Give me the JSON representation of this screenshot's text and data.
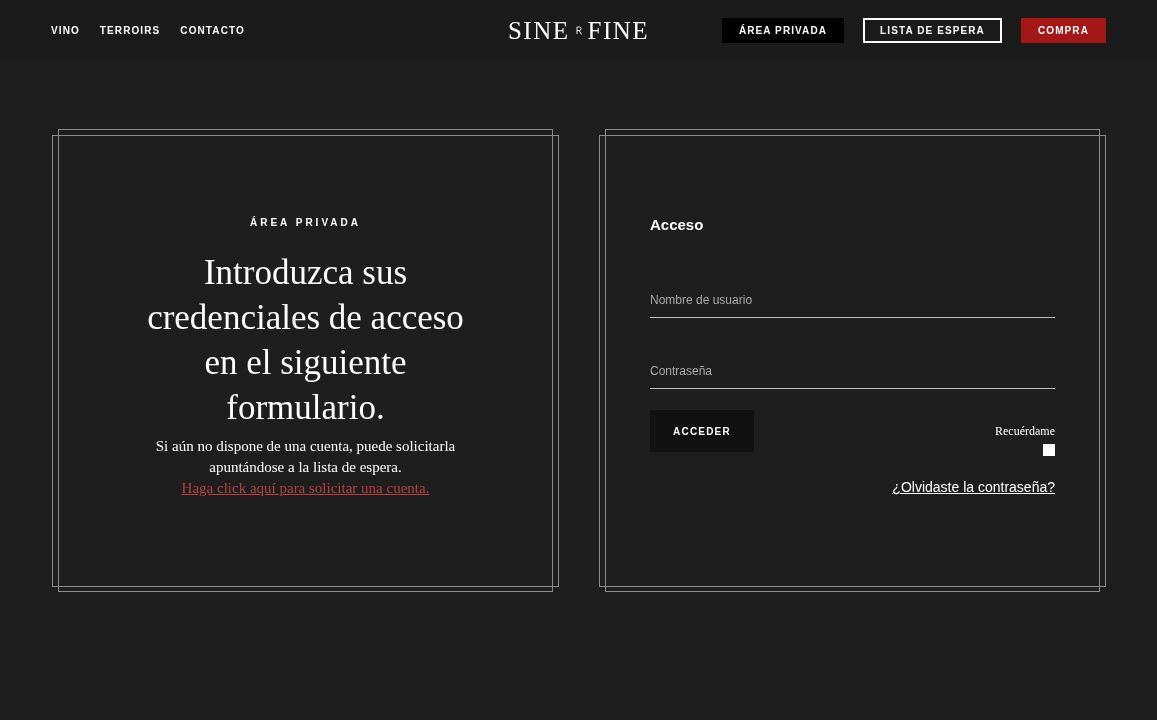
{
  "nav": {
    "links": [
      "VINO",
      "TERROIRS",
      "CONTACTO"
    ]
  },
  "logo": {
    "words": [
      "SINE",
      "FINE"
    ]
  },
  "header_buttons": [
    {
      "label": "ÁREA PRIVADA",
      "kind": "dark"
    },
    {
      "label": "LISTA DE ESPERA",
      "kind": "outline"
    },
    {
      "label": "COMPRA",
      "kind": "primary"
    }
  ],
  "intro": {
    "eyebrow": "ÁREA PRIVADA",
    "heading": "Introduzca sus credenciales de acceso en el siguiente formulario.",
    "text": "Si aún no dispone de una cuenta, puede solicitarla apuntándose a la lista de espera.",
    "link": "Haga click aquí para solicitar una cuenta."
  },
  "login": {
    "title": "Acceso",
    "fields": [
      {
        "placeholder": "Nombre de usuario"
      },
      {
        "placeholder": "Contraseña"
      }
    ],
    "submit": "ACCEDER",
    "remember": {
      "label": "Recuérdame",
      "checked": false
    },
    "forgot_link": "¿Olvidaste la contraseña?"
  }
}
